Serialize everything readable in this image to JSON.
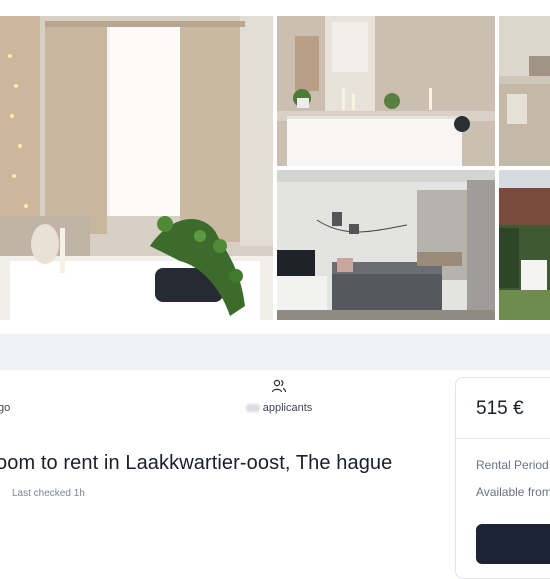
{
  "listing": {
    "posted_suffix": "go",
    "applicants_label": "applicants",
    "title": "oom to rent in Laakkwartier-oost, The hague",
    "last_checked": "Last checked 1h"
  },
  "pricing": {
    "price": "515 €",
    "rental_period_label": "Rental Period",
    "available_from_label": "Available from"
  },
  "icons": {
    "applicants": "users-icon"
  },
  "colors": {
    "page_bg": "#ffffff",
    "strip_bg": "#f1f2f5",
    "button_bg": "#1c2337",
    "muted_text": "#7d8390"
  }
}
